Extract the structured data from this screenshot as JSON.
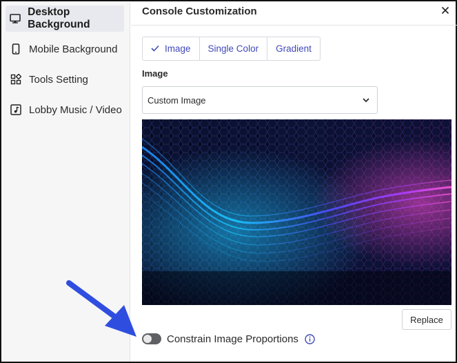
{
  "sidebar": {
    "items": [
      {
        "label": "Desktop Background",
        "icon": "monitor-icon",
        "active": true
      },
      {
        "label": "Mobile Background",
        "icon": "phone-icon",
        "active": false
      },
      {
        "label": "Tools Setting",
        "icon": "tools-grid-icon",
        "active": false
      },
      {
        "label": "Lobby Music / Video",
        "icon": "music-note-icon",
        "active": false
      }
    ]
  },
  "panel": {
    "title": "Console Customization",
    "close_icon": "close-icon"
  },
  "tabs": [
    {
      "label": "Image",
      "selected": true
    },
    {
      "label": "Single Color",
      "selected": false
    },
    {
      "label": "Gradient",
      "selected": false
    }
  ],
  "image_field": {
    "label": "Image",
    "select_value": "Custom Image"
  },
  "actions": {
    "replace_label": "Replace"
  },
  "constrain": {
    "label": "Constrain Image Proportions",
    "enabled": false,
    "info_icon": "info-icon"
  },
  "colors": {
    "accent": "#3f49b8",
    "annotation_arrow": "#2f4ee0",
    "toggle_off": "#5f6064"
  }
}
